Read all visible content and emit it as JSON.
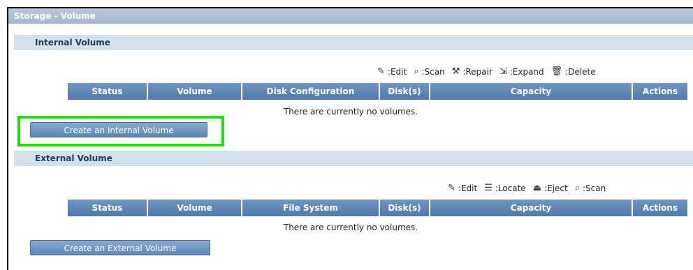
{
  "title": "Storage - Volume",
  "internal": {
    "section_title": "Internal Volume",
    "legend": [
      {
        "icon": "edit-icon",
        "glyph": "✎",
        "label": ":Edit"
      },
      {
        "icon": "scan-icon",
        "glyph": "⌕",
        "label": ":Scan"
      },
      {
        "icon": "repair-icon",
        "glyph": "⚒",
        "label": ":Repair"
      },
      {
        "icon": "expand-icon",
        "glyph": "⇲",
        "label": ":Expand"
      },
      {
        "icon": "delete-icon",
        "glyph": "🗑",
        "label": ":Delete"
      }
    ],
    "columns": [
      "Status",
      "Volume",
      "Disk Configuration",
      "Disk(s)",
      "Capacity",
      "Actions"
    ],
    "empty_message": "There are currently no volumes.",
    "button_label": "Create an Internal Volume"
  },
  "external": {
    "section_title": "External Volume",
    "legend": [
      {
        "icon": "edit-icon",
        "glyph": "✎",
        "label": ":Edit"
      },
      {
        "icon": "locate-icon",
        "glyph": "☰",
        "label": ":Locate"
      },
      {
        "icon": "eject-icon",
        "glyph": "⏏",
        "label": ":Eject"
      },
      {
        "icon": "scan-icon",
        "glyph": "⌕",
        "label": ":Scan"
      }
    ],
    "columns": [
      "Status",
      "Volume",
      "File System",
      "Disk(s)",
      "Capacity",
      "Actions"
    ],
    "empty_message": "There are currently no volumes.",
    "button_label": "Create an External Volume"
  },
  "colors": {
    "highlight": "#22dd11",
    "header_blue": "#5b84b2",
    "section_bg": "#d4e0ec"
  }
}
